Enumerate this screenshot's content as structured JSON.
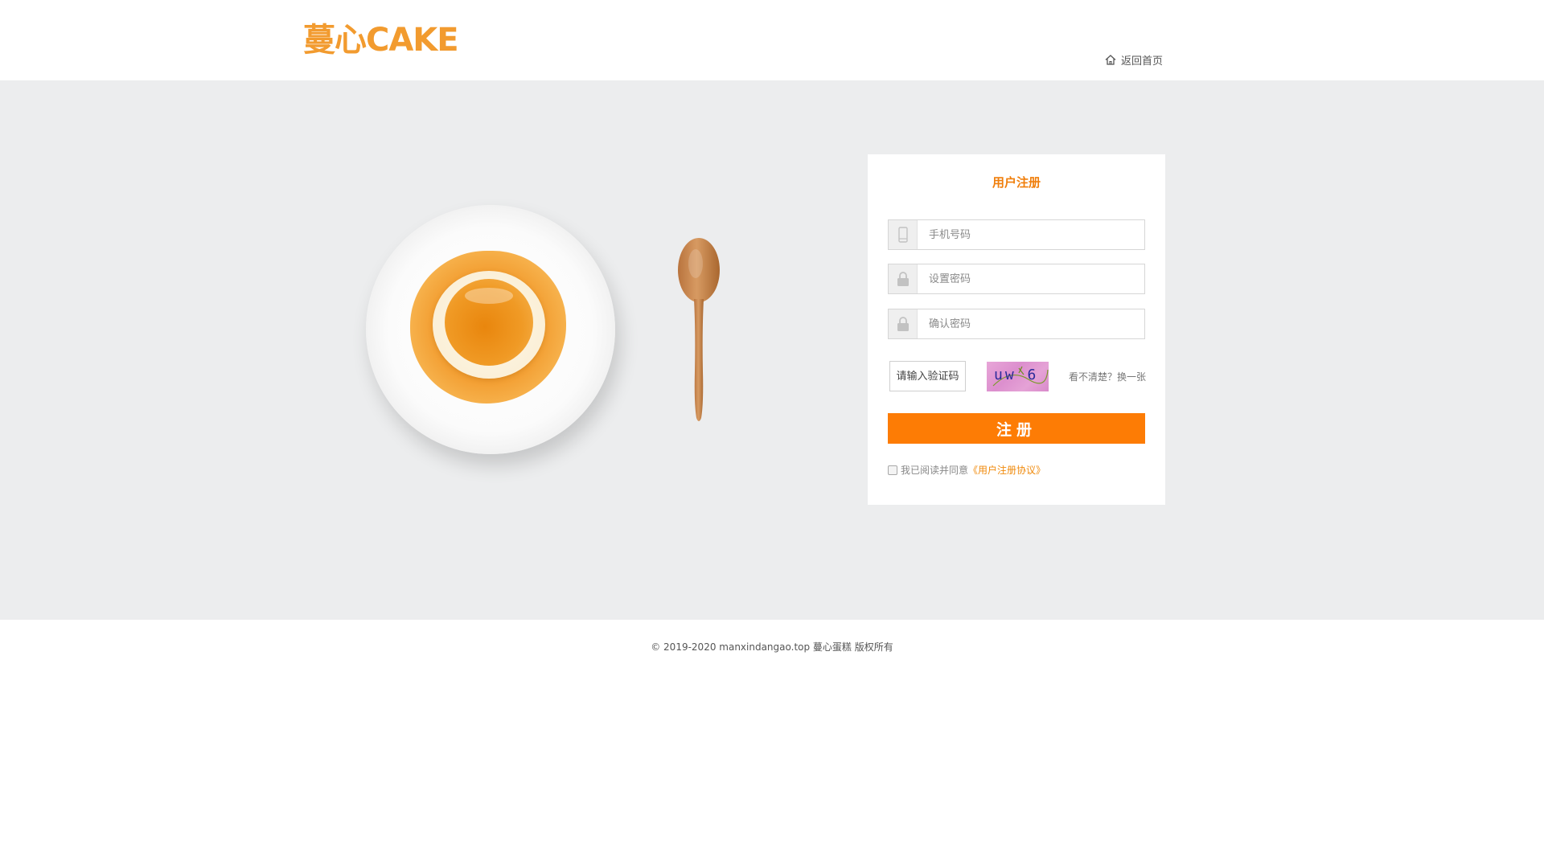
{
  "header": {
    "logo_text": "蔓心CAKE",
    "home_link_label": "返回首页"
  },
  "form": {
    "title": "用户注册",
    "phone_placeholder": "手机号码",
    "password_placeholder": "设置密码",
    "confirm_placeholder": "确认密码",
    "captcha_placeholder": "请输入验证码",
    "captcha_image_text": "uw 6",
    "refresh_label": "看不清楚？换一张",
    "submit_label": "注册",
    "agree_text": "我已阅读并同意",
    "agreement_link": "《用户注册协议》"
  },
  "footer": {
    "copyright": "© 2019-2020 manxindangao.top 蔓心蛋糕  版权所有"
  },
  "colors": {
    "accent": "#fd7c05",
    "logo": "#f29b2f",
    "background_band": "#ecedee"
  },
  "icons": [
    "home-icon",
    "phone-icon",
    "lock-icon"
  ]
}
